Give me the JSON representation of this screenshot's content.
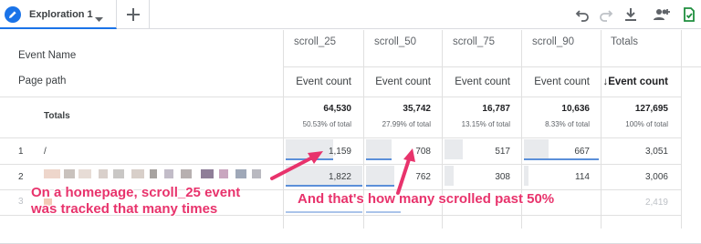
{
  "tab": {
    "label": "Exploration 1",
    "icon": "pencil-icon"
  },
  "toolbar": {
    "icons": [
      "undo-icon",
      "redo-icon",
      "download-icon",
      "share-add-user-icon",
      "save-check-icon"
    ]
  },
  "table": {
    "dimension_headers": {
      "event_name": "Event Name",
      "page_path": "Page path"
    },
    "event_columns": [
      "scroll_25",
      "scroll_50",
      "scroll_75",
      "scroll_90",
      "Totals"
    ],
    "metric_label": "Event count",
    "sorted_metric_label": "↓Event count",
    "totals": {
      "label": "Totals",
      "values": [
        "64,530",
        "35,742",
        "16,787",
        "10,636",
        "127,695"
      ],
      "percents": [
        "50.53% of total",
        "27.99% of total",
        "13.15% of total",
        "8.33% of total",
        "100% of total"
      ]
    },
    "rows": [
      {
        "num": "1",
        "path": "/",
        "values": [
          "1,159",
          "708",
          "517",
          "667",
          "3,051"
        ]
      },
      {
        "num": "2",
        "path": "",
        "values": [
          "1,822",
          "762",
          "308",
          "114",
          "3,006"
        ]
      },
      {
        "num": "3",
        "path": "",
        "values": [
          "",
          "",
          "",
          "",
          "2,419"
        ]
      }
    ]
  },
  "annotations": {
    "left_line1": "On a homepage, scroll_25 event",
    "left_line2": "was tracked that many times",
    "right": "And that's how many scrolled past 50%",
    "color": "#e8336c"
  },
  "colors": {
    "accent": "#1a73e8",
    "bar": "#e8eaed",
    "bar_line": "#5b8fd9"
  }
}
